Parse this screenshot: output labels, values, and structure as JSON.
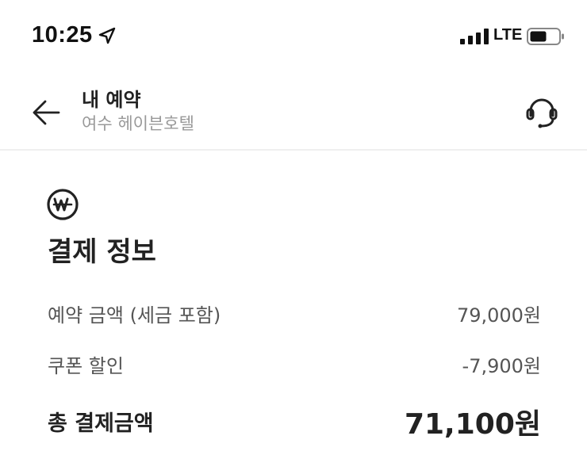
{
  "status_bar": {
    "time": "10:25",
    "network": "LTE",
    "icons": [
      "location-arrow-icon",
      "signal-icon",
      "battery-icon"
    ]
  },
  "header": {
    "title": "내 예약",
    "subtitle": "여수 헤이븐호텔",
    "icons": [
      "back-arrow-icon",
      "headset-icon"
    ]
  },
  "payment": {
    "icon": "won-icon",
    "title": "결제 정보",
    "rows": [
      {
        "label": "예약 금액 (세금 포함)",
        "value": "79,000원"
      },
      {
        "label": "쿠폰 할인",
        "value": "-7,900원"
      }
    ],
    "total": {
      "label": "총 결제금액",
      "value": "71,100원"
    }
  },
  "colors": {
    "text_primary": "#222222",
    "text_secondary": "#555555",
    "text_muted": "#999999",
    "divider": "#efefef"
  }
}
